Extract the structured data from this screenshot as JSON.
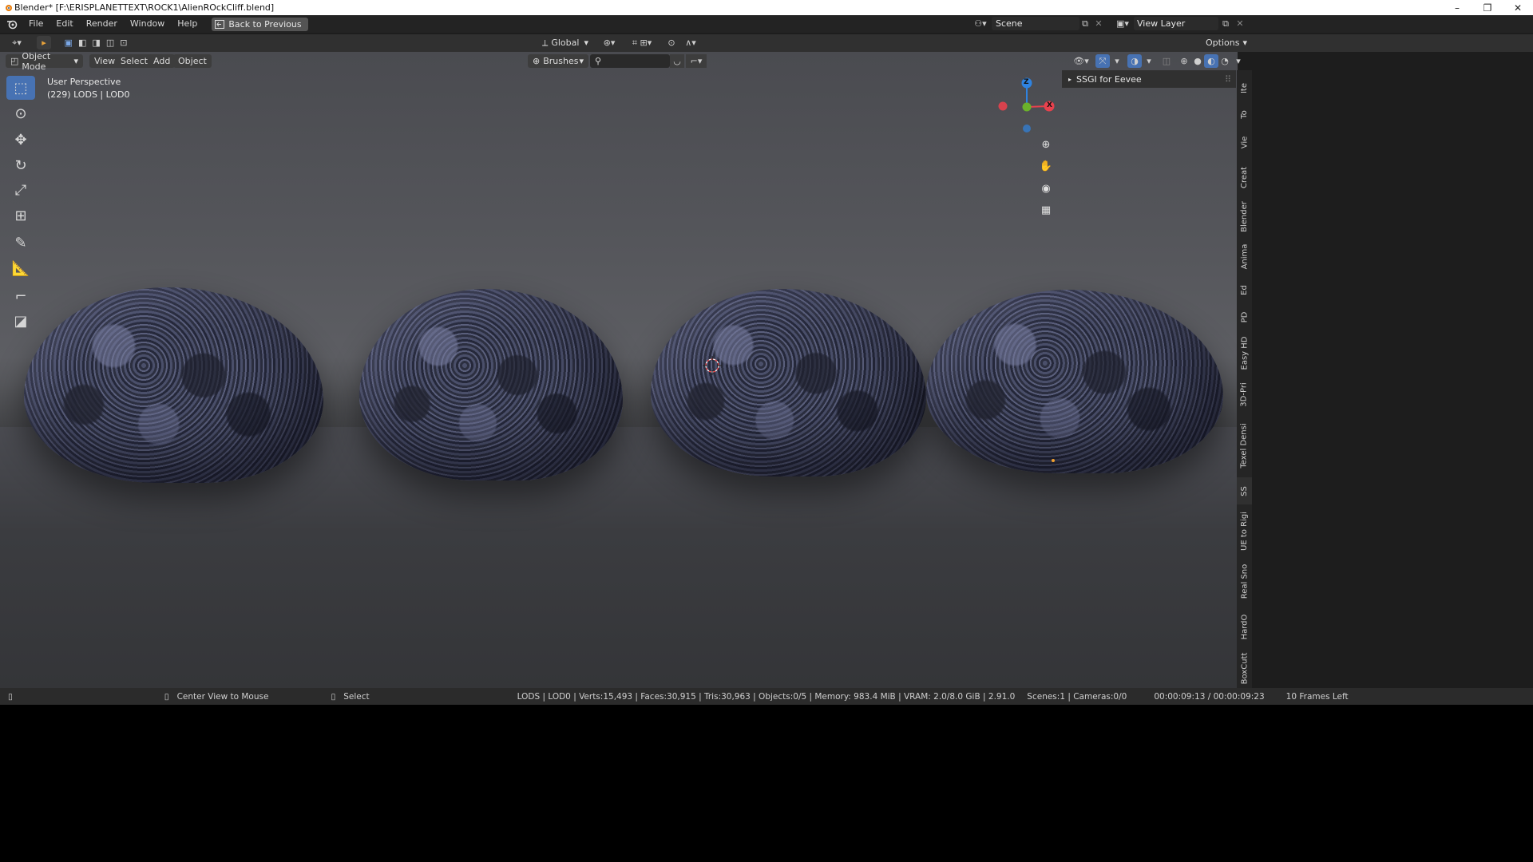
{
  "window": {
    "title": "Blender* [F:\\ERISPLANETTEXT\\ROCK1\\AlienROckCliff.blend]",
    "controls": [
      "–",
      "❐",
      "✕"
    ]
  },
  "menu": {
    "items": [
      "File",
      "Edit",
      "Render",
      "Window",
      "Help"
    ],
    "back_button": "Back to Previous"
  },
  "scene": {
    "scene_name": "Scene",
    "view_layer": "View Layer"
  },
  "tool_header": {
    "transform_orientation": "Global",
    "options": "Options"
  },
  "viewport_header": {
    "mode": "Object Mode",
    "menus": [
      "View",
      "Select",
      "Add",
      "Object"
    ],
    "brushes": "Brushes"
  },
  "viewport": {
    "perspective": "User Perspective",
    "object_info": "(229) LODS | LOD0",
    "gizmo_axes": {
      "z": "Z",
      "x": "X"
    }
  },
  "npanel": {
    "panel_title": "SSGI for Eevee"
  },
  "side_tabs": [
    "Ite",
    "To",
    "Vie",
    "Creat",
    "Blender",
    "Anima",
    "Ed",
    "PD",
    "Easy HD",
    "3D-Pri",
    "Texel Densi",
    "SS",
    "UE to Rigi",
    "Real Sno",
    "HardO",
    "BoxCutt"
  ],
  "status": {
    "left_hint": "Center View to Mouse",
    "mid_hint": "Select",
    "stats": "LODS | LOD0 | Verts:15,493 | Faces:30,915 | Tris:30,963 | Objects:0/5 | Memory: 983.4 MiB | VRAM: 2.0/8.0 GiB | 2.91.0",
    "scenes": "Scenes:1 | Cameras:0/0",
    "time": "00:00:09:13 / 00:00:09:23",
    "frames": "10 Frames Left"
  },
  "colors": {
    "accent": "#4772b3",
    "axis_x": "#e8414d",
    "axis_y": "#6bb22b",
    "axis_z": "#2f83e0"
  }
}
